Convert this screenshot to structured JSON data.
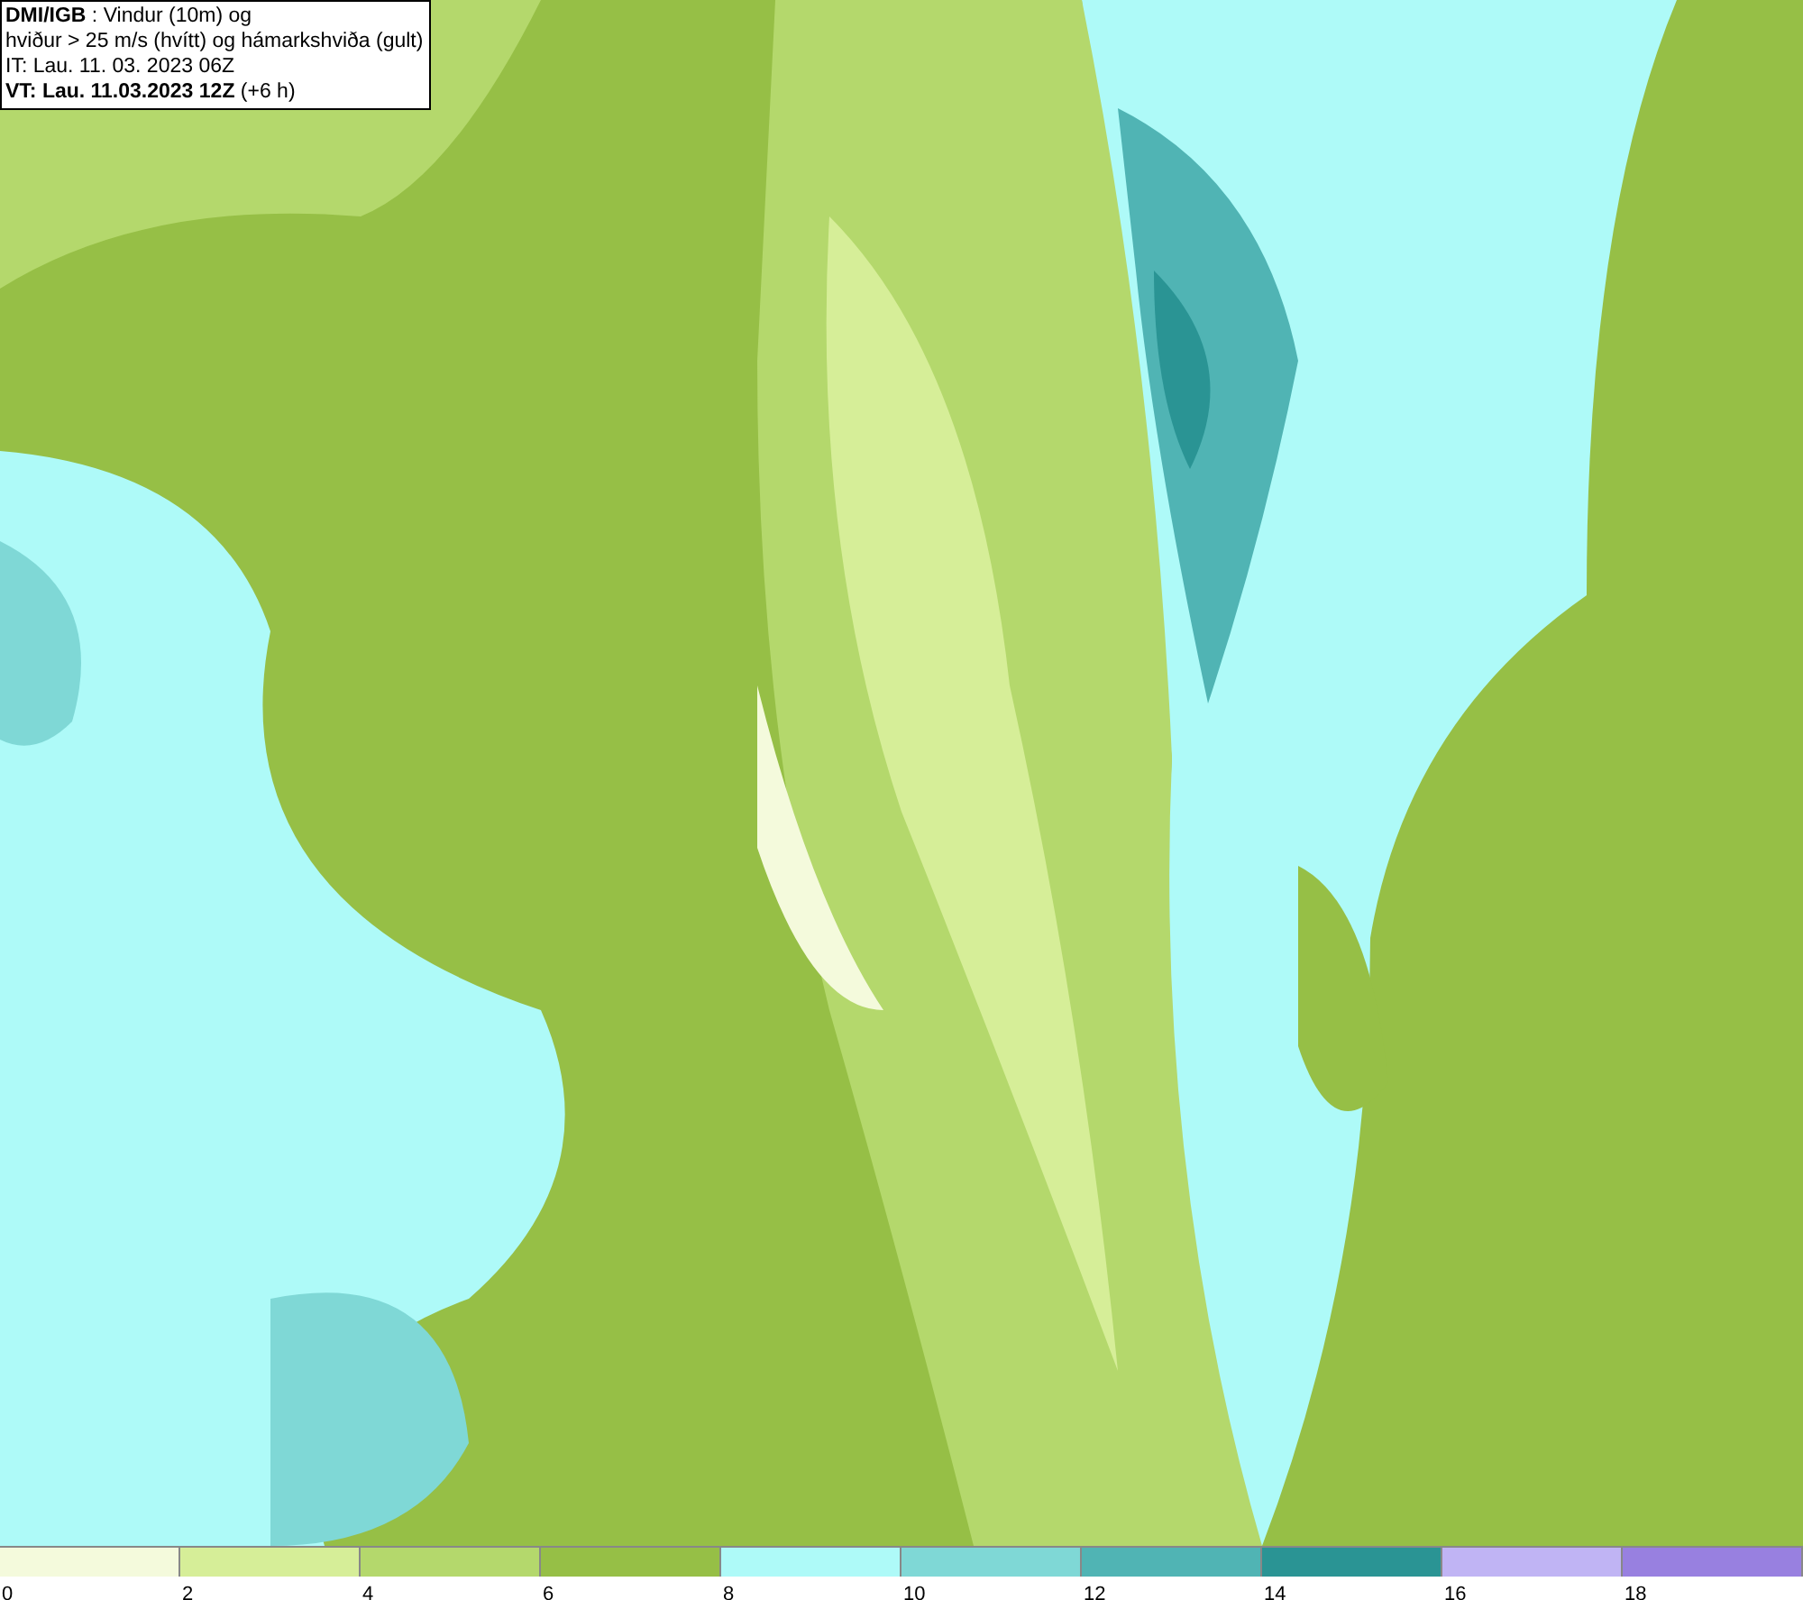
{
  "header": {
    "lines": [
      "**DMI/IGB** : Vindur (10m) og",
      "hviður > 25 m/s (hvítt) og hámarkshviða (gult)",
      "IT: Lau. 11. 03. 2023 06Z",
      "**VT: Lau. 11.03.2023 12Z** (+6 h)"
    ]
  },
  "legend": [
    {
      "label": "0",
      "color": "#f4fadc"
    },
    {
      "label": "2",
      "color": "#d6ee98"
    },
    {
      "label": "4",
      "color": "#b4d86c"
    },
    {
      "label": "6",
      "color": "#96bf46"
    },
    {
      "label": "8",
      "color": "#aefaf8"
    },
    {
      "label": "10",
      "color": "#7fd8d6"
    },
    {
      "label": "12",
      "color": "#50b4b4"
    },
    {
      "label": "14",
      "color": "#2a9494"
    },
    {
      "label": "16",
      "color": "#c0b4f4"
    },
    {
      "label": "18",
      "color": "#9880e0"
    }
  ]
}
